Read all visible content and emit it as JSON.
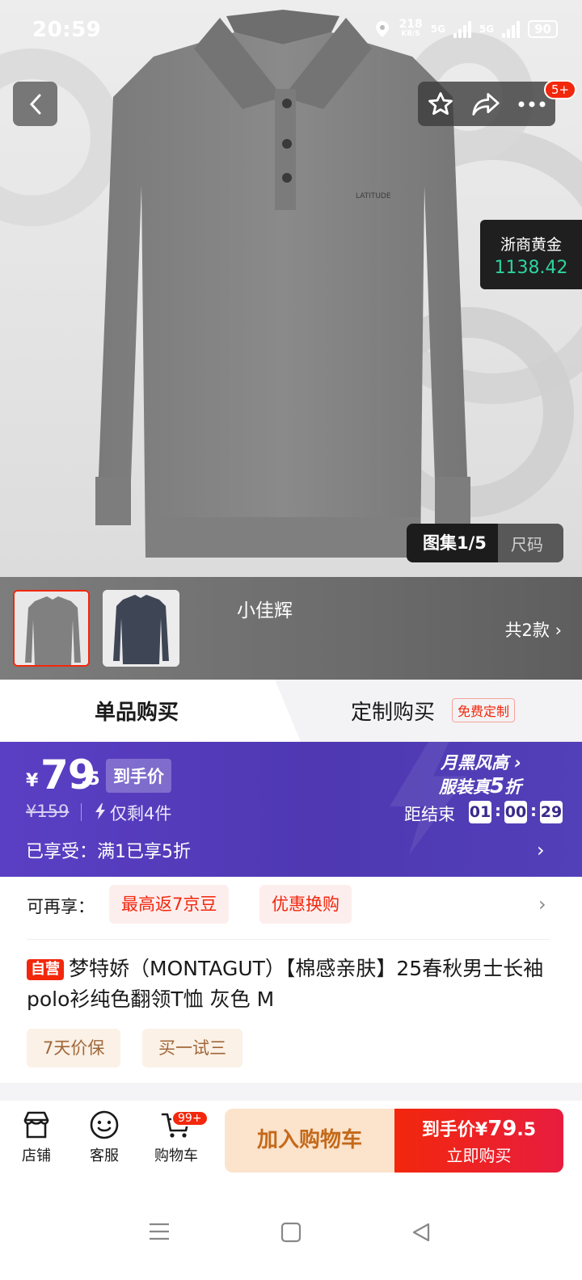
{
  "status_bar": {
    "time": "20:59",
    "speed_value": "218",
    "speed_unit": "KB/S",
    "net1": "5G",
    "net2": "5G",
    "battery": "90"
  },
  "hero": {
    "brand_tag": "LATITUDE",
    "cart_badge": "5+",
    "gold": {
      "name": "浙商黄金",
      "value": "1138.42"
    },
    "gallery": {
      "active": "图集1/5",
      "inactive": "尺码"
    }
  },
  "variants": {
    "name": "小佳辉",
    "count": "共2款 ›"
  },
  "purchase_tabs": {
    "single": "单品购买",
    "custom": "定制购买",
    "free_tag": "免费定制"
  },
  "price": {
    "currency": "¥",
    "integer": "79",
    "decimal": ".5",
    "label": "到手价",
    "original": "¥159",
    "stock": "仅剩4件",
    "enjoyed": "已享受：满1已享5折",
    "promo_line1": "月黑风高 ›",
    "promo_line2_pre": "服装真",
    "promo_line2_num": "5",
    "promo_line2_post": "折",
    "countdown_label": "距结束",
    "countdown": [
      "01",
      "00",
      "29"
    ]
  },
  "more_benefits": {
    "label": "可再享：",
    "tags": [
      "最高返7京豆",
      "优惠换购"
    ]
  },
  "product": {
    "self_tag": "自营",
    "title": "梦特娇（MONTAGUT）【棉感亲肤】25春秋男士长袖polo衫纯色翻领T恤 灰色  M",
    "services": [
      "7天价保",
      "买一试三"
    ]
  },
  "bottom_bar": {
    "store": "店铺",
    "service": "客服",
    "cart": "购物车",
    "cart_badge": "99+",
    "add_to_cart": "加入购物车",
    "buy_price_pre": "到手价¥",
    "buy_price_int": "79",
    "buy_price_dec": ".5",
    "buy_now": "立即购买"
  },
  "colors": {
    "accent": "#f2270c",
    "promo_purple": "#5a3fc4",
    "gold_green": "#2ed3a0"
  }
}
